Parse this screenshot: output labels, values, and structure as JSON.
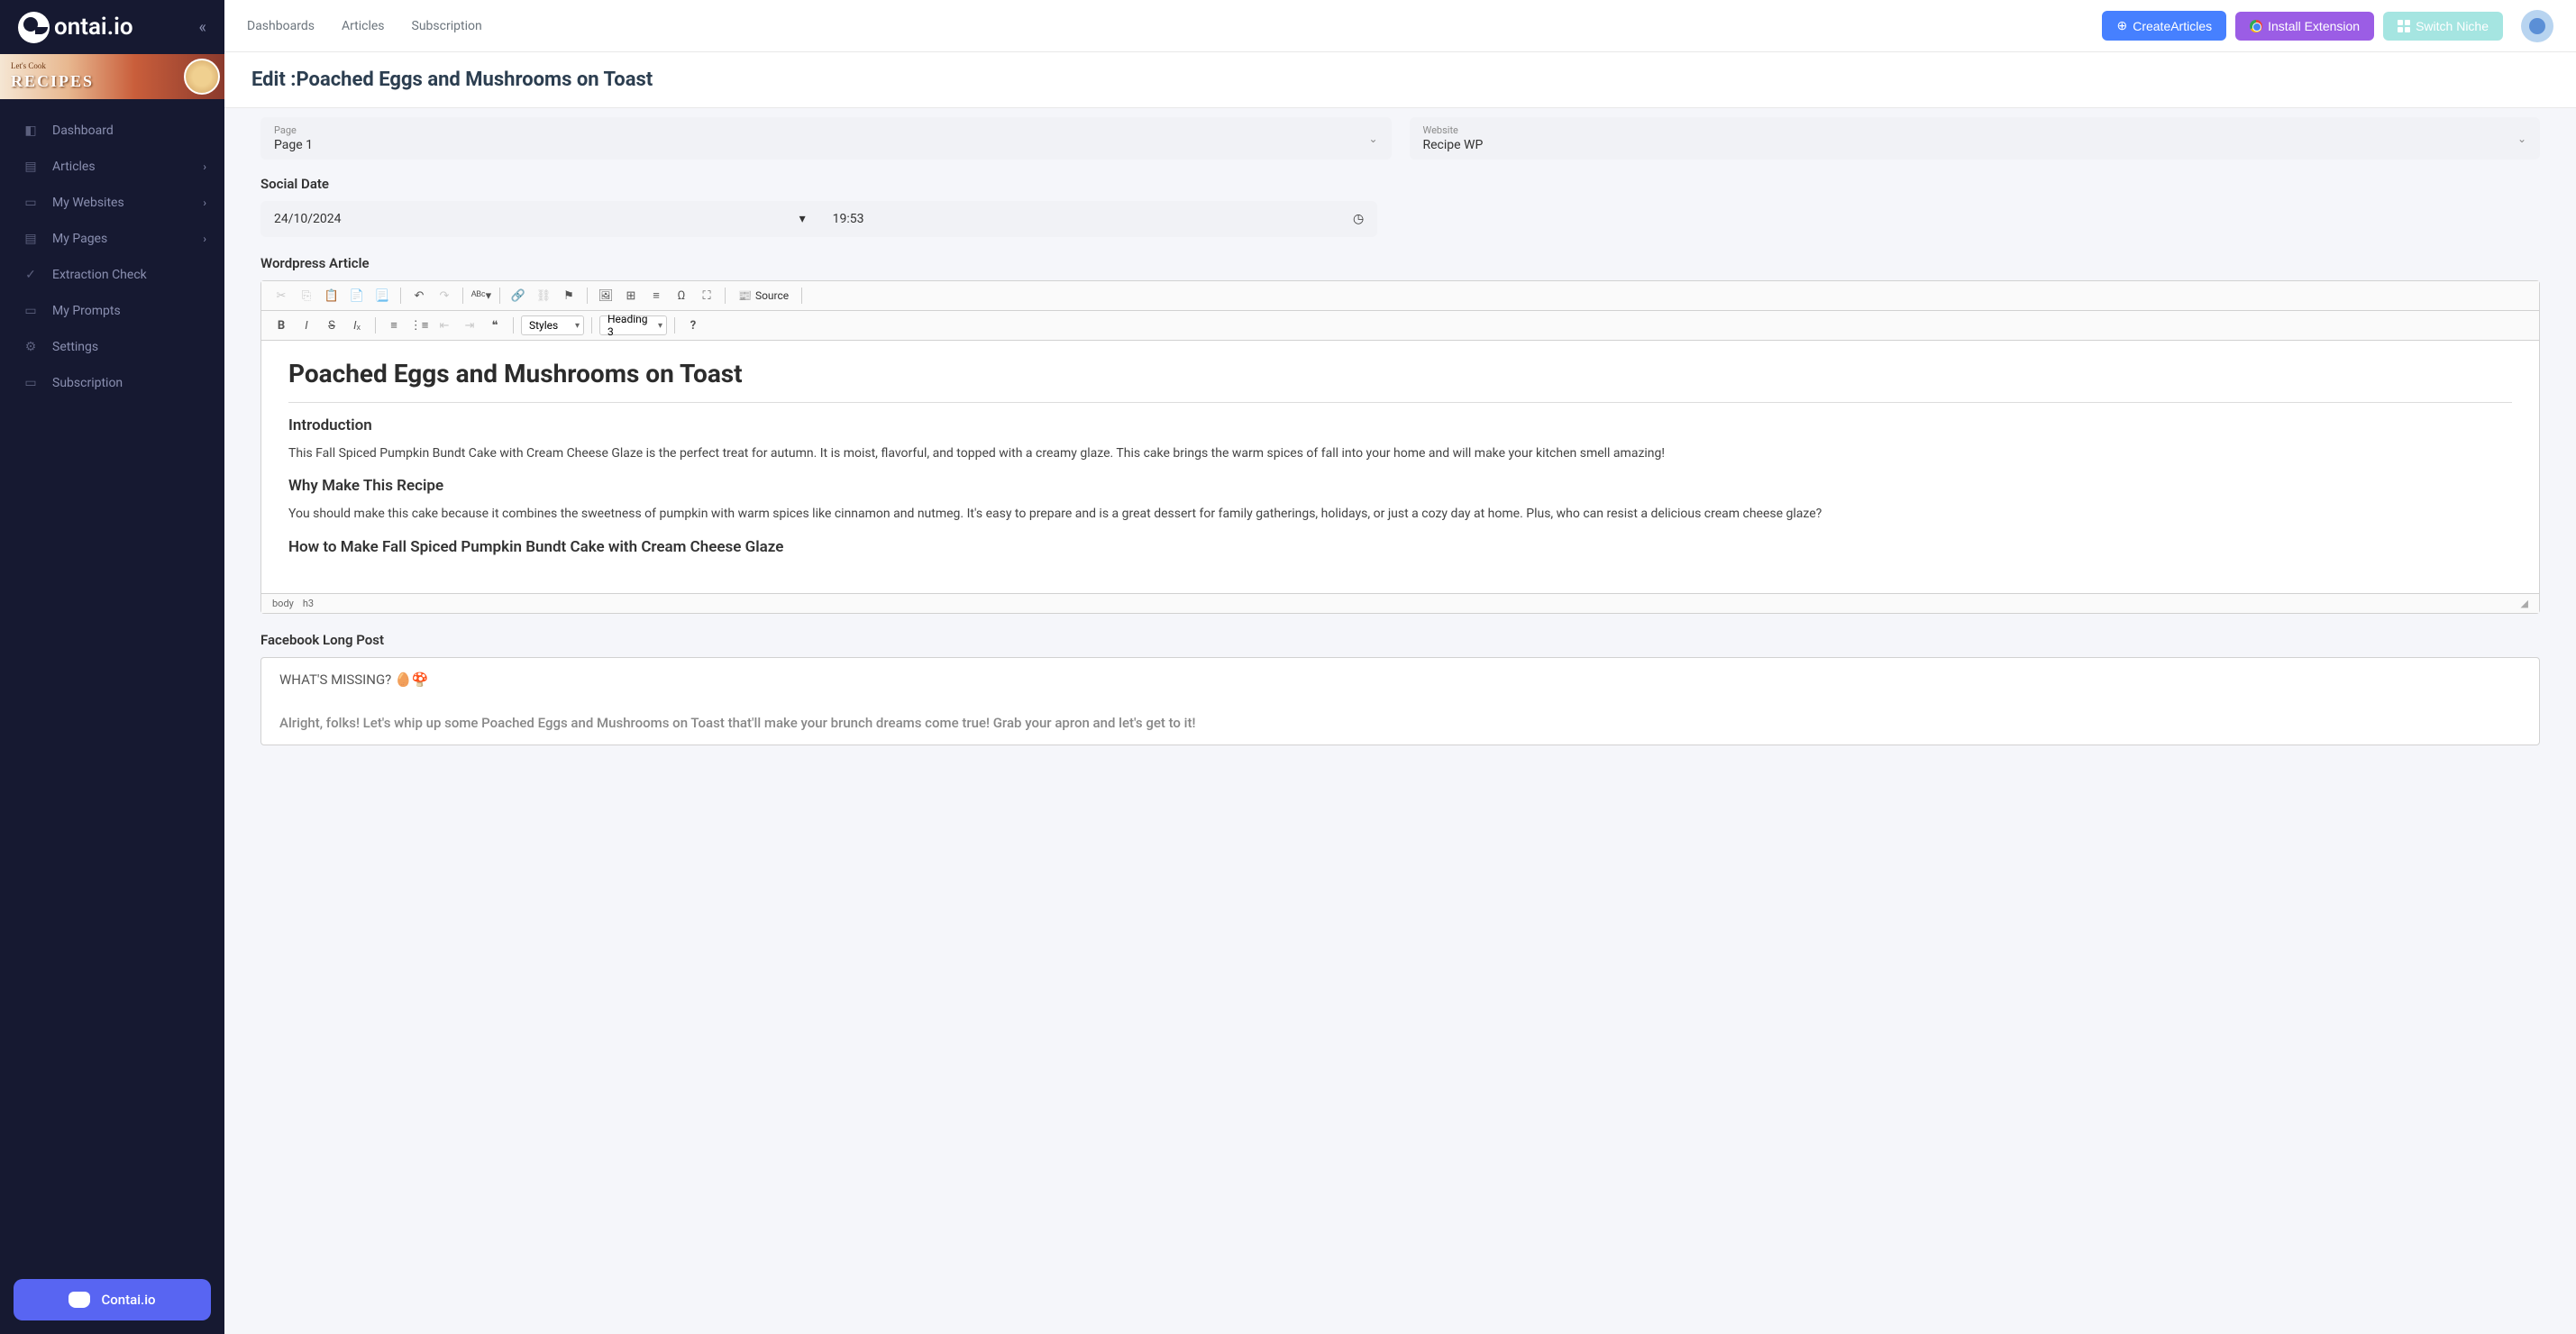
{
  "app": {
    "logo_text": "ontai.io"
  },
  "banner": {
    "subtitle": "Let's Cook",
    "title": "RECIPES"
  },
  "sidebar": {
    "items": [
      {
        "label": "Dashboard",
        "expandable": false
      },
      {
        "label": "Articles",
        "expandable": true
      },
      {
        "label": "My Websites",
        "expandable": true
      },
      {
        "label": "My Pages",
        "expandable": true
      },
      {
        "label": "Extraction Check",
        "expandable": false
      },
      {
        "label": "My Prompts",
        "expandable": false
      },
      {
        "label": "Settings",
        "expandable": false
      },
      {
        "label": "Subscription",
        "expandable": false
      }
    ]
  },
  "discord": {
    "label": "Contai.io"
  },
  "topnav": {
    "items": [
      "Dashboards",
      "Articles",
      "Subscription"
    ]
  },
  "actions": {
    "create": "CreateArticles",
    "extension": "Install Extension",
    "switch": "Switch Niche"
  },
  "page": {
    "title": "Edit :Poached Eggs and Mushrooms on Toast"
  },
  "form": {
    "page_label": "Page",
    "page_value": "Page 1",
    "website_label": "Website",
    "website_value": "Recipe WP",
    "social_date_label": "Social Date",
    "date_value": "24/10/2024",
    "time_value": "19:53",
    "wordpress_label": "Wordpress Article",
    "facebook_label": "Facebook Long Post"
  },
  "editor": {
    "styles_label": "Styles",
    "format_label": "Heading 3",
    "source_label": "Source",
    "path_body": "body",
    "path_h3": "h3",
    "content": {
      "title": "Poached Eggs and Mushrooms on Toast",
      "h1": "Introduction",
      "p1": "This Fall Spiced Pumpkin Bundt Cake with Cream Cheese Glaze is the perfect treat for autumn. It is moist, flavorful, and topped with a creamy glaze. This cake brings the warm spices of fall into your home and will make your kitchen smell amazing!",
      "h2": "Why Make This Recipe",
      "p2": "You should make this cake because it combines the sweetness of pumpkin with warm spices like cinnamon and nutmeg. It's easy to prepare and is a great dessert for family gatherings, holidays, or just a cozy day at home. Plus, who can resist a delicious cream cheese glaze?",
      "h3": "How to Make Fall Spiced Pumpkin Bundt Cake with Cream Cheese Glaze"
    }
  },
  "facebook": {
    "line1": "WHAT'S MISSING? 🥚🍄",
    "line2": "Alright, folks! Let's whip up some Poached Eggs and Mushrooms on Toast that'll make your brunch dreams come true! Grab your apron and let's get to it!"
  }
}
